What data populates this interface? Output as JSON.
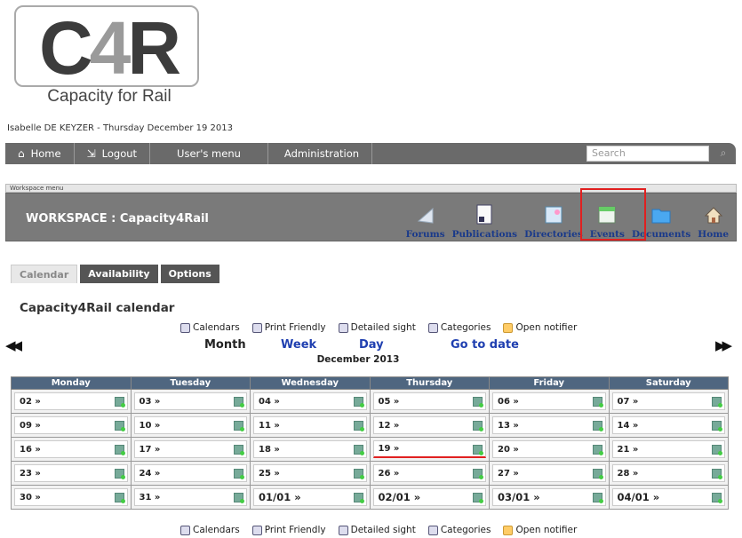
{
  "logo": {
    "mark": "C4R",
    "mark_c": "C",
    "mark_4": "4",
    "mark_r": "R",
    "tagline": "Capacity for Rail"
  },
  "user_line": "Isabelle DE KEYZER  - Thursday December 19 2013",
  "topnav": {
    "items": [
      {
        "label": "Home",
        "icon": "home-icon"
      },
      {
        "label": "Logout",
        "icon": "logout-icon"
      },
      {
        "label": "User's menu"
      },
      {
        "label": "Administration"
      }
    ],
    "search_placeholder": "Search"
  },
  "workspace": {
    "menu_label": "Workspace menu",
    "title": "WORKSPACE : Capacity4Rail",
    "icons": [
      {
        "label": "Forums",
        "icon": "forums-icon"
      },
      {
        "label": "Publications",
        "icon": "publications-icon"
      },
      {
        "label": "Directories",
        "icon": "directories-icon"
      },
      {
        "label": "Events",
        "icon": "events-icon"
      },
      {
        "label": "Documents",
        "icon": "documents-icon"
      },
      {
        "label": "Home",
        "icon": "home-icon"
      }
    ]
  },
  "tabs": [
    "Calendar",
    "Availability",
    "Options"
  ],
  "calendar": {
    "title": "Capacity4Rail calendar",
    "toolbar": [
      "Calendars",
      "Print Friendly",
      "Detailed sight",
      "Categories",
      "Open notifier"
    ],
    "periods": {
      "month": "Month",
      "week": "Week",
      "day": "Day",
      "goto": "Go to date"
    },
    "current": "December 2013",
    "days": [
      "Monday",
      "Tuesday",
      "Wednesday",
      "Thursday",
      "Friday",
      "Saturday"
    ],
    "rows": [
      [
        "02 »",
        "03 »",
        "04 »",
        "05 »",
        "06 »",
        "07 »"
      ],
      [
        "09 »",
        "10 »",
        "11 »",
        "12 »",
        "13 »",
        "14 »"
      ],
      [
        "16 »",
        "17 »",
        "18 »",
        "19 »",
        "20 »",
        "21 »"
      ],
      [
        "23 »",
        "24 »",
        "25 »",
        "26 »",
        "27 »",
        "28 »"
      ],
      [
        "30 »",
        "31 »",
        "01/01 »",
        "02/01 »",
        "03/01 »",
        "04/01 »"
      ]
    ]
  },
  "colors": {
    "nav_bg": "#6a6a6a",
    "header_bg": "#4f6680",
    "link": "#1f3fb0",
    "highlight": "#e02020"
  }
}
